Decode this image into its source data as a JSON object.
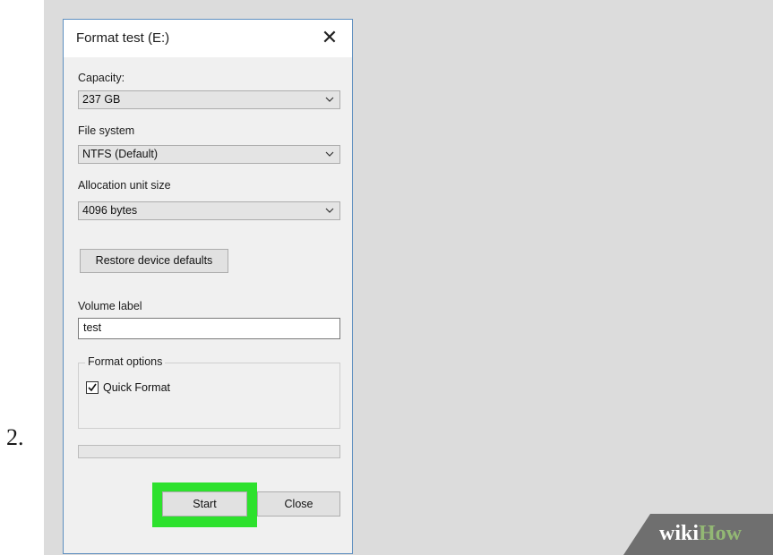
{
  "step": {
    "number": "2."
  },
  "dialog": {
    "title": "Format test (E:)",
    "close_icon": "close-icon",
    "capacity": {
      "label": "Capacity:",
      "value": "237 GB"
    },
    "file_system": {
      "label": "File system",
      "value": "NTFS (Default)"
    },
    "allocation_unit_size": {
      "label": "Allocation unit size",
      "value": "4096 bytes"
    },
    "restore_defaults_label": "Restore device defaults",
    "volume_label": {
      "label": "Volume label",
      "value": "test"
    },
    "format_options": {
      "legend": "Format options",
      "quick_format": {
        "label": "Quick Format",
        "checked": true
      }
    },
    "progress": {
      "value": 0
    },
    "start_label": "Start",
    "close_label": "Close"
  },
  "colors": {
    "highlight": "#2de12d",
    "dialog_border": "#5e8fc0",
    "watermark_green": "#93b874"
  },
  "watermark": {
    "part1": "wiki",
    "part2": "How"
  }
}
